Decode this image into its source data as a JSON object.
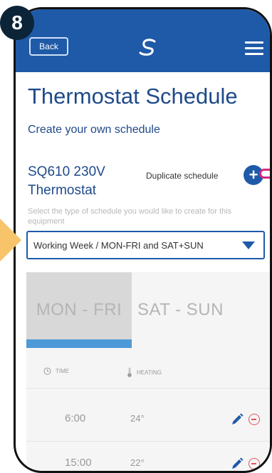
{
  "step": {
    "number": "8"
  },
  "header": {
    "back_label": "Back",
    "logo_icon": "s-wave-logo-icon",
    "menu_icon": "hamburger-menu-icon",
    "bar_color": "#1f5aa8"
  },
  "page": {
    "title": "Thermostat Schedule",
    "subtitle": "Create your own schedule"
  },
  "device": {
    "name": "SQ610 230V Thermostat",
    "duplicate_label": "Duplicate schedule",
    "duplicate_icon": "plus-icon",
    "helper_text": "Select the type of schedule you would like to create for this equipment"
  },
  "schedule_select": {
    "value": "Working Week / MON-FRI and SAT+SUN",
    "caret_icon": "caret-down-icon"
  },
  "tabs": [
    {
      "label": "MON - FRI",
      "active": true
    },
    {
      "label": "SAT - SUN",
      "active": false
    }
  ],
  "table": {
    "columns": [
      {
        "label": "TIME",
        "icon": "clock-icon"
      },
      {
        "label": "HEATING",
        "icon": "thermometer-icon"
      }
    ],
    "rows": [
      {
        "time": "6:00",
        "heating": "24°"
      },
      {
        "time": "15:00",
        "heating": "22°"
      }
    ]
  },
  "colors": {
    "accent": "#1f5aa8",
    "title": "#1f4a8a",
    "remove": "#e2545c",
    "highlight_arrow": "#f7c46a",
    "pointer": "#d42a7e"
  }
}
